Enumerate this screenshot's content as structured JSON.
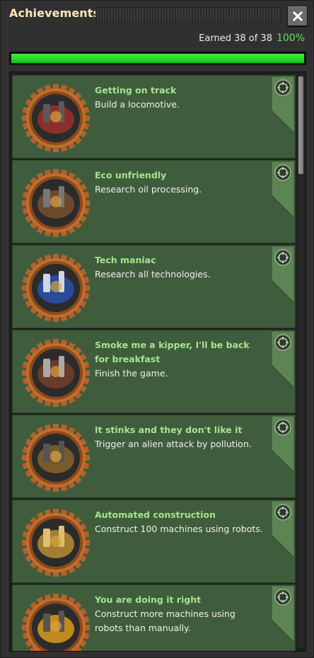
{
  "window": {
    "title": "Achievements",
    "close_icon": "close-icon"
  },
  "summary": {
    "earned_text": "Earned 38 of 38",
    "percent_text": "100%",
    "progress_fraction": 1.0,
    "accent_color": "#5fe35f"
  },
  "achievements": [
    {
      "title": "Getting on track",
      "description": "Build a locomotive.",
      "icon": "locomotive-icon"
    },
    {
      "title": "Eco unfriendly",
      "description": "Research oil processing.",
      "icon": "oil-refinery-icon"
    },
    {
      "title": "Tech maniac",
      "description": "Research all technologies.",
      "icon": "tech-sphere-icon"
    },
    {
      "title": "Smoke me a kipper, I'll be back for breakfast",
      "description": "Finish the game.",
      "icon": "rocket-icon"
    },
    {
      "title": "It stinks and they don't like it",
      "description": "Trigger an alien attack by pollution.",
      "icon": "alien-factory-icon"
    },
    {
      "title": "Automated construction",
      "description": "Construct 100 machines using robots.",
      "icon": "construction-robot-icon"
    },
    {
      "title": "You are doing it right",
      "description": "Construct more machines using robots than manually.",
      "icon": "robot-building-icon"
    }
  ],
  "colors": {
    "item_background": "#3f5d3c",
    "title_color": "#a7e38f",
    "window_title_color": "#ffe6c0"
  }
}
